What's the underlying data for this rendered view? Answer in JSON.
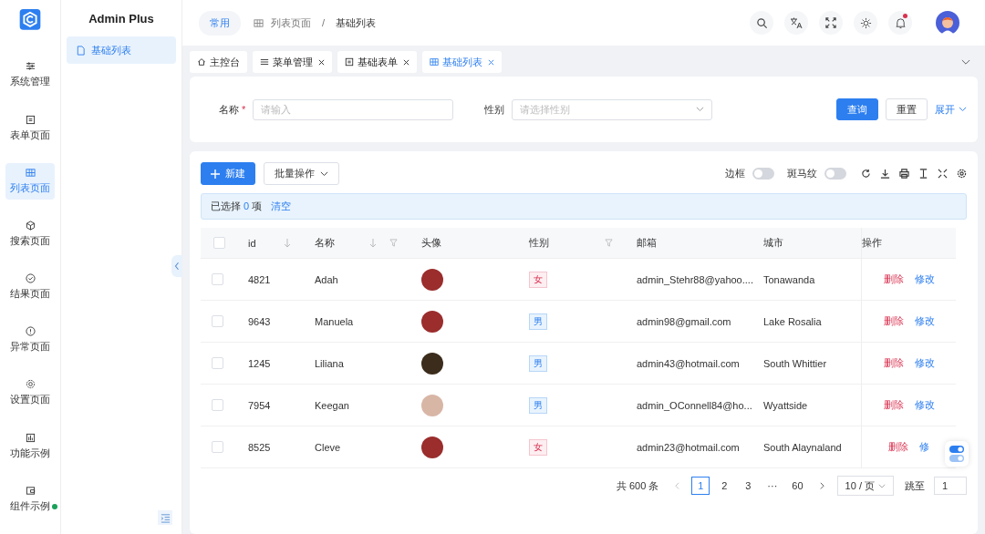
{
  "app_title": "Admin Plus",
  "rail": [
    {
      "label": "系统管理",
      "selected": false,
      "dot": false
    },
    {
      "label": "表单页面",
      "selected": false,
      "dot": false
    },
    {
      "label": "列表页面",
      "selected": true,
      "dot": false
    },
    {
      "label": "搜索页面",
      "selected": false,
      "dot": false
    },
    {
      "label": "结果页面",
      "selected": false,
      "dot": false
    },
    {
      "label": "异常页面",
      "selected": false,
      "dot": false
    },
    {
      "label": "设置页面",
      "selected": false,
      "dot": false
    },
    {
      "label": "功能示例",
      "selected": false,
      "dot": false
    },
    {
      "label": "组件示例",
      "selected": false,
      "dot": true
    }
  ],
  "submenu": [
    {
      "label": "基础列表",
      "selected": true
    }
  ],
  "header": {
    "chip": "常用",
    "breadcrumb": [
      "列表页面",
      "基础列表"
    ],
    "separator": "/",
    "notification_dot": true
  },
  "tabs": [
    {
      "label": "主控台",
      "closable": false,
      "selected": false
    },
    {
      "label": "菜单管理",
      "closable": true,
      "selected": false
    },
    {
      "label": "基础表单",
      "closable": true,
      "selected": false
    },
    {
      "label": "基础列表",
      "closable": true,
      "selected": true
    }
  ],
  "search_form": {
    "fields": [
      {
        "label": "名称",
        "required_mark": "*",
        "placeholder": "请输入",
        "kind": "input"
      },
      {
        "label": "性别",
        "placeholder": "请选择性别",
        "kind": "select"
      }
    ],
    "query": "查询",
    "reset": "重置",
    "expand": "展开"
  },
  "toolbar": {
    "new": "新建",
    "batch": "批量操作",
    "switches": [
      {
        "label": "边框",
        "on": false
      },
      {
        "label": "斑马纹",
        "on": false
      }
    ]
  },
  "selection": {
    "prefix": "已选择",
    "count": "0",
    "suffix": "项",
    "clear": "清空"
  },
  "table": {
    "all_checked": false,
    "columns": [
      {
        "label": "id",
        "sortable": true,
        "filterable": false
      },
      {
        "label": "名称",
        "sortable": true,
        "filterable": true
      },
      {
        "label": "头像",
        "sortable": false,
        "filterable": false
      },
      {
        "label": "性别",
        "sortable": false,
        "filterable": true
      },
      {
        "label": "邮箱",
        "sortable": false,
        "filterable": false
      },
      {
        "label": "城市",
        "sortable": false,
        "filterable": false
      },
      {
        "label": "操作",
        "sortable": false,
        "filterable": false
      }
    ],
    "rows": [
      {
        "checked": false,
        "id": "4821",
        "name": "Adah",
        "avatar": {
          "color": "#9b2d2d"
        },
        "gender": {
          "label": "女",
          "kind": "female"
        },
        "email": "admin_Stehr88@yahoo....",
        "city": "Tonawanda",
        "actions": [
          "删除",
          "修改"
        ]
      },
      {
        "checked": false,
        "id": "9643",
        "name": "Manuela",
        "avatar": {
          "color": "#9b2d2d"
        },
        "gender": {
          "label": "男",
          "kind": "male"
        },
        "email": "admin98@gmail.com",
        "city": "Lake Rosalia",
        "actions": [
          "删除",
          "修改"
        ]
      },
      {
        "checked": false,
        "id": "1245",
        "name": "Liliana",
        "avatar": {
          "color": "#3b2c1c"
        },
        "gender": {
          "label": "男",
          "kind": "male"
        },
        "email": "admin43@hotmail.com",
        "city": "South Whittier",
        "actions": [
          "删除",
          "修改"
        ]
      },
      {
        "checked": false,
        "id": "7954",
        "name": "Keegan",
        "avatar": {
          "color": "#d8b6a6"
        },
        "gender": {
          "label": "男",
          "kind": "male"
        },
        "email": "admin_OConnell84@ho...",
        "city": "Wyattside",
        "actions": [
          "删除",
          "修改"
        ]
      },
      {
        "checked": false,
        "id": "8525",
        "name": "Cleve",
        "avatar": {
          "color": "#9b2d2d"
        },
        "gender": {
          "label": "女",
          "kind": "female"
        },
        "email": "admin23@hotmail.com",
        "city": "South Alaynaland",
        "actions": [
          "删除",
          "修"
        ]
      }
    ]
  },
  "pagination": {
    "total": "共 600 条",
    "pages": [
      {
        "label": "1",
        "selected": true
      },
      {
        "label": "2",
        "selected": false
      },
      {
        "label": "3",
        "selected": false
      },
      {
        "label": "···",
        "selected": false
      },
      {
        "label": "60",
        "selected": false
      }
    ],
    "page_size": "10 / 页",
    "jump_label": "跳至",
    "jump_value": "1"
  }
}
